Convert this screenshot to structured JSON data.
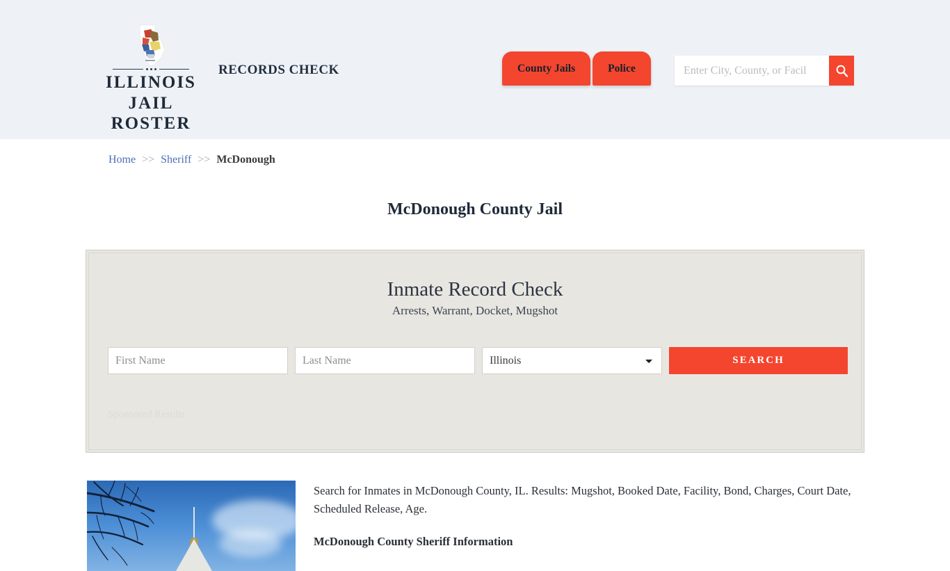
{
  "header": {
    "brand": {
      "line1": "ILLINOIS",
      "line2": "JAIL ROSTER",
      "mark_icon": "illinois-state-outline-icon"
    },
    "tagline": "RECORDS CHECK",
    "nav": [
      {
        "label": "County Jails",
        "name": "county-jails"
      },
      {
        "label": "Police",
        "name": "police"
      }
    ],
    "search": {
      "placeholder": "Enter City, County, or Facil",
      "value": "",
      "button_icon": "search-icon"
    },
    "background_color": "#eef2f7",
    "accent_color": "#f4452f"
  },
  "breadcrumb": {
    "items": [
      {
        "label": "Home",
        "link": true
      },
      {
        "label": "Sheriff",
        "link": true
      },
      {
        "label": "McDonough",
        "link": false
      }
    ],
    "separator": ">>"
  },
  "page": {
    "title": "McDonough County Jail"
  },
  "search_panel": {
    "title": "Inmate Record Check",
    "subtitle": "Arrests, Warrant, Docket, Mugshot",
    "first_name": {
      "placeholder": "First Name",
      "value": ""
    },
    "last_name": {
      "placeholder": "Last Name",
      "value": ""
    },
    "state": {
      "selected": "Illinois",
      "options": [
        "Illinois"
      ]
    },
    "submit_label": "SEARCH",
    "sponsored_label": "Sponsored Results",
    "background_color": "#e8e6e1"
  },
  "content": {
    "thumbnail_alt": "mcdonough-county-courthouse-photo",
    "paragraph": "Search for Inmates in McDonough County, IL. Results: Mugshot, Booked Date, Facility, Bond, Charges, Court Date, Scheduled Release, Age.",
    "subheading": "McDonough County Sheriff Information"
  }
}
